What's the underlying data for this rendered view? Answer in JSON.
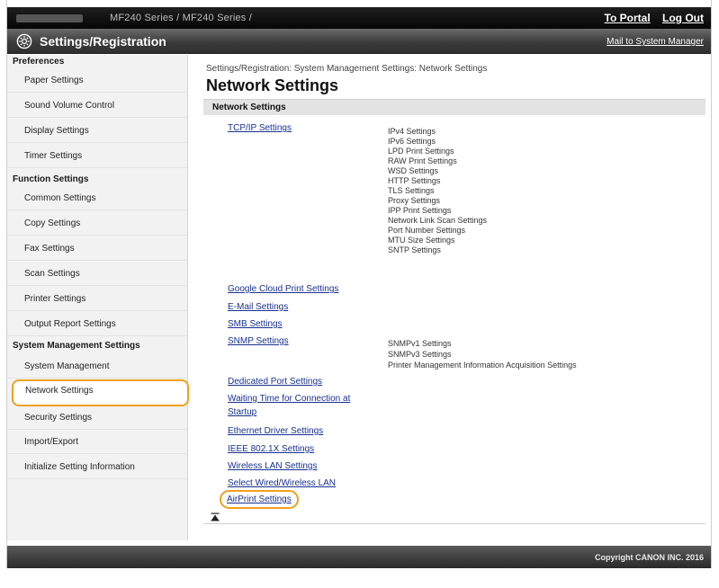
{
  "topbar": {
    "breadcrumb": "MF240 Series / MF240 Series /",
    "to_portal": "To Portal",
    "log_out": "Log Out"
  },
  "titlebar": {
    "title": "Settings/Registration",
    "mail": "Mail to System Manager"
  },
  "sidebar": {
    "preferences": {
      "heading": "Preferences",
      "items": [
        "Paper Settings",
        "Sound Volume Control",
        "Display Settings",
        "Timer Settings"
      ]
    },
    "function": {
      "heading": "Function Settings",
      "items": [
        "Common Settings",
        "Copy Settings",
        "Fax Settings",
        "Scan Settings",
        "Printer Settings",
        "Output Report Settings"
      ]
    },
    "system": {
      "heading": "System Management Settings",
      "items": [
        "System Management",
        "Network Settings",
        "Security Settings",
        "Import/Export",
        "Initialize Setting Information"
      ]
    },
    "selected": "Network Settings"
  },
  "main": {
    "breadcrumb": "Settings/Registration: System Management Settings: Network Settings",
    "title": "Network Settings",
    "section": "Network Settings",
    "links": {
      "tcpip": "TCP/IP Settings",
      "google": "Google Cloud Print Settings",
      "email": "E-Mail Settings",
      "smb": "SMB Settings",
      "snmp": "SNMP Settings",
      "dedicated": "Dedicated Port Settings",
      "waiting_1": "Waiting Time for Connection at",
      "waiting_2": "Startup",
      "ethernet": "Ethernet Driver Settings",
      "ieee": "IEEE 802.1X Settings",
      "wireless": "Wireless LAN Settings",
      "select_lan": "Select Wired/Wireless LAN",
      "airprint": "AirPrint Settings"
    },
    "tcpip_sub": [
      "IPv4 Settings",
      "IPv6 Settings",
      "LPD Print Settings",
      "RAW Print Settings",
      "WSD Settings",
      "HTTP Settings",
      "TLS Settings",
      "Proxy Settings",
      "IPP Print Settings",
      "Network Link Scan Settings",
      "Port Number Settings",
      "MTU Size Settings",
      "SNTP Settings"
    ],
    "snmp_sub": [
      "SNMPv1 Settings",
      "SNMPv3 Settings",
      "Printer Management Information Acquisition Settings"
    ]
  },
  "footer": {
    "copyright": "Copyright CANON INC. 2016"
  },
  "colors": {
    "link": "#17308f",
    "highlight": "#f0a01e",
    "header_dark": "#0a0a0a"
  },
  "icons": {
    "app": "settings-gear-icon",
    "back_to_top": "back-to-top-icon"
  }
}
